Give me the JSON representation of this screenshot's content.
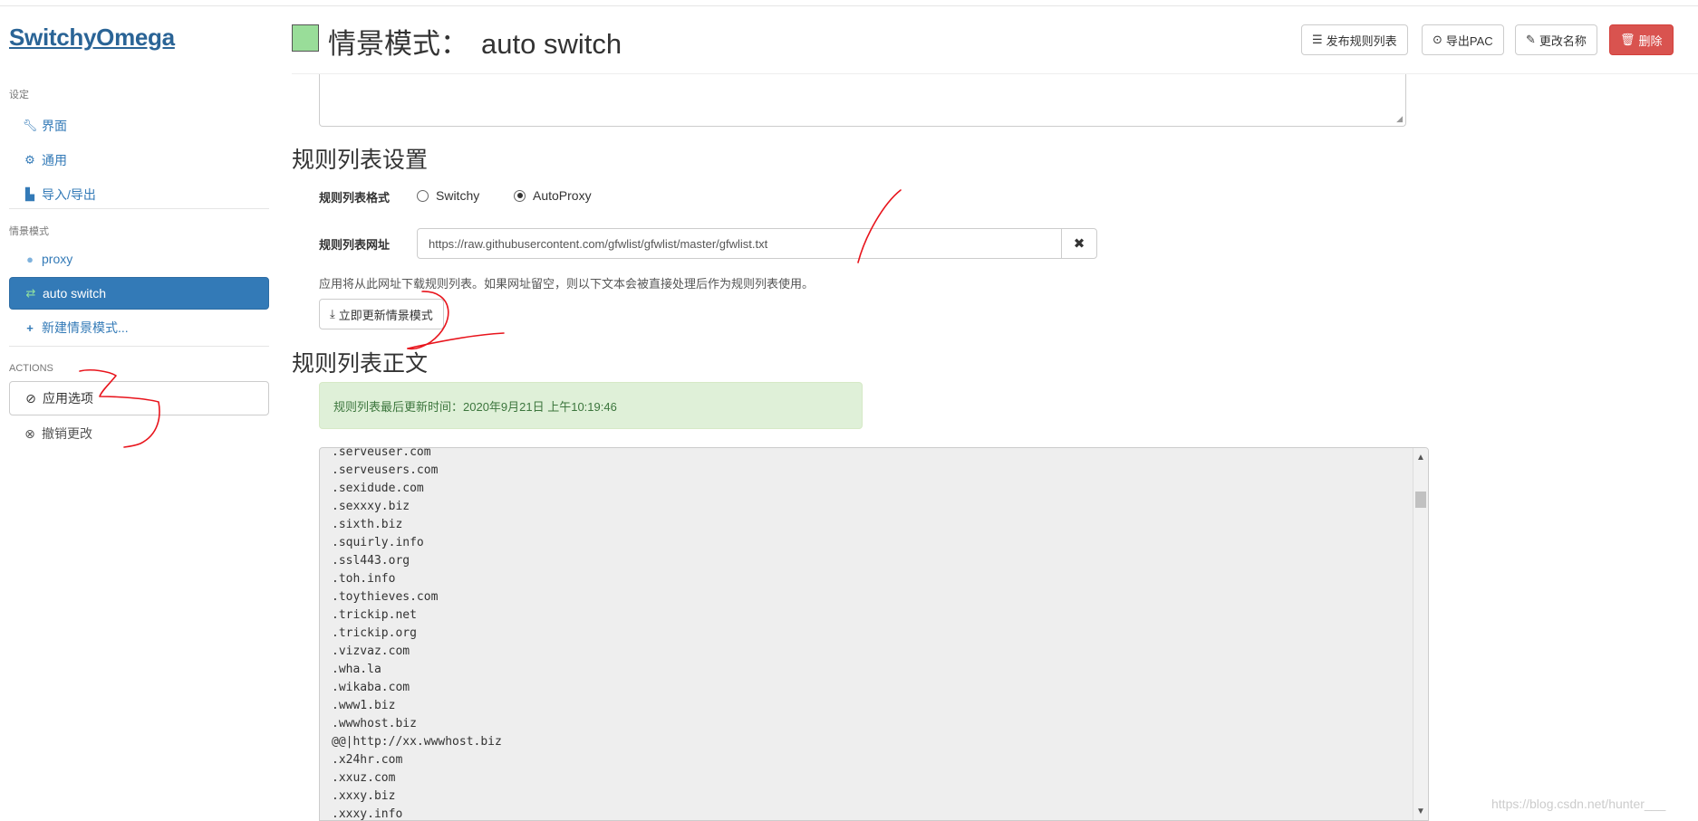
{
  "brand": "SwitchyOmega",
  "sidebar": {
    "settings_header": "设定",
    "settings_items": [
      {
        "label": "界面",
        "icon": "wrench-icon"
      },
      {
        "label": "通用",
        "icon": "gear-icon"
      },
      {
        "label": "导入/导出",
        "icon": "floppy-icon"
      }
    ],
    "profiles_header": "情景模式",
    "profile_items": [
      {
        "label": "proxy",
        "icon": "globe-icon"
      },
      {
        "label": "auto switch",
        "icon": "retweet-icon",
        "active": true
      },
      {
        "label": "新建情景模式...",
        "icon": "plus-icon"
      }
    ],
    "actions_header": "ACTIONS",
    "apply_label": "应用选项",
    "revert_label": "撤销更改"
  },
  "header": {
    "title_prefix": "情景模式：",
    "profile_name": "auto switch",
    "swatch_color": "#99dd99",
    "buttons": {
      "publish": "发布规则列表",
      "export_pac": "导出PAC",
      "rename": "更改名称",
      "delete": "删除"
    }
  },
  "rule_list_settings": {
    "section_title": "规则列表设置",
    "format_label": "规则列表格式",
    "format_options": [
      "Switchy",
      "AutoProxy"
    ],
    "format_selected": "AutoProxy",
    "url_label": "规则列表网址",
    "url_value": "https://raw.githubusercontent.com/gfwlist/gfwlist/master/gfwlist.txt",
    "help_text": "应用将从此网址下载规则列表。如果网址留空，则以下文本会被直接处理后作为规则列表使用。",
    "update_button": "立即更新情景模式"
  },
  "rule_list_text": {
    "section_title": "规则列表正文",
    "last_updated": "规则列表最后更新时间：2020年9月21日 上午10:19:46",
    "lines": [
      ".serveuser.com",
      ".serveusers.com",
      ".sexidude.com",
      ".sexxxy.biz",
      ".sixth.biz",
      ".squirly.info",
      ".ssl443.org",
      ".toh.info",
      ".toythieves.com",
      ".trickip.net",
      ".trickip.org",
      ".vizvaz.com",
      ".wha.la",
      ".wikaba.com",
      ".www1.biz",
      ".wwwhost.biz",
      "@@|http://xx.wwwhost.biz",
      ".x24hr.com",
      ".xxuz.com",
      ".xxxy.biz",
      ".xxxy.info"
    ]
  },
  "watermark": "https://blog.csdn.net/hunter___",
  "colors": {
    "accent": "#337ab7",
    "danger": "#d9534f",
    "success_bg": "#dff0d8",
    "annotation": "#e8141c"
  }
}
